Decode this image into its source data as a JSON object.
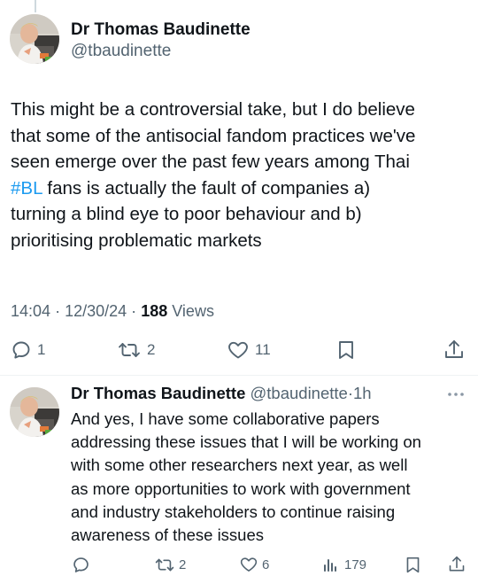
{
  "main_tweet": {
    "author_name": "Dr Thomas Baudinette",
    "author_handle": "@tbaudinette",
    "text_lines": [
      "This might be a controversial take, but I do believe",
      "that some of the antisocial fandom practices we've",
      "seen emerge over the past few years among Thai",
      "fans is actually the fault of companies a)",
      "turning a blind eye to poor behaviour and b)",
      "prioritising problematic markets"
    ],
    "hashtag": "#BL",
    "time": "14:04",
    "date": "12/30/24",
    "separator": "·",
    "views_count": "188",
    "views_label": "Views",
    "replies": "1",
    "reposts": "2",
    "likes": "11"
  },
  "reply_tweet": {
    "author_name": "Dr Thomas Baudinette",
    "author_handle": "@tbaudinette",
    "separator": "·",
    "time_ago": "1h",
    "text": "And yes, I have some collaborative papers\naddressing these issues that I will be working on\nwith some other researchers next year, as well\nas more opportunities to work with government\nand industry stakeholders to continue raising\nawareness of these issues",
    "reposts": "2",
    "likes": "6",
    "views": "179"
  },
  "colors": {
    "text": "#0f1419",
    "secondary": "#536471",
    "link": "#1d9bf0",
    "divider": "#eff3f4",
    "thread_line": "#cfd9de"
  },
  "icons": [
    "avatar-photo",
    "reply-icon",
    "repost-icon",
    "like-icon",
    "bookmark-icon",
    "share-icon",
    "more-icon",
    "views-icon"
  ]
}
